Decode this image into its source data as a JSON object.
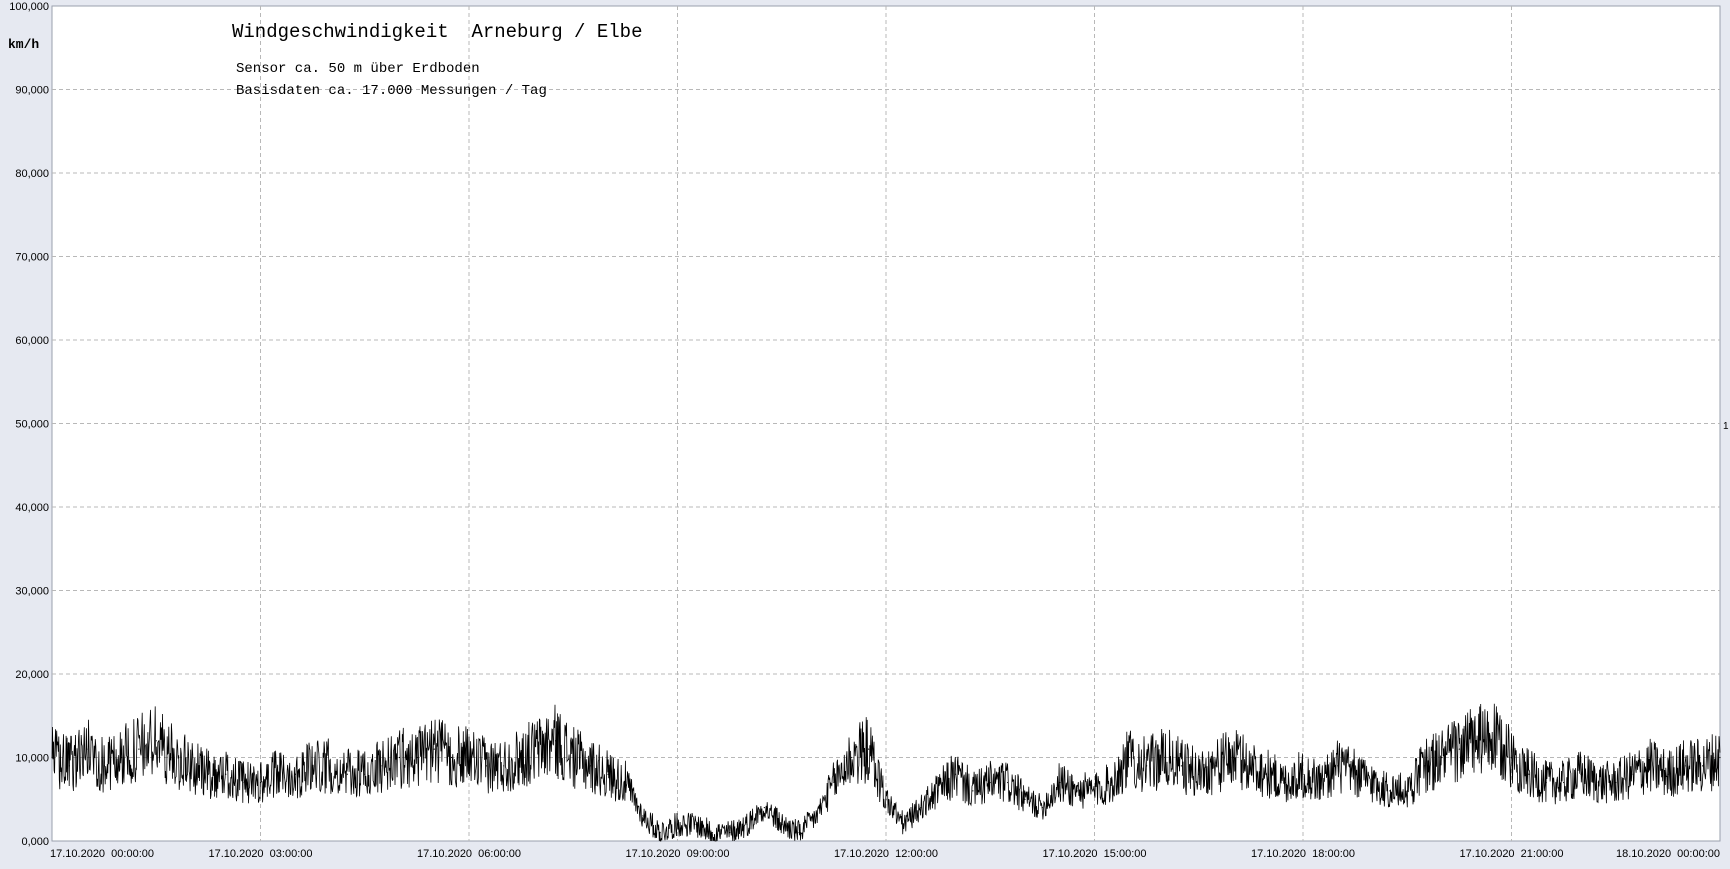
{
  "chart_data": {
    "type": "line",
    "title": "Windgeschwindigkeit  Arneburg / Elbe",
    "subtitle_lines": [
      "Sensor ca. 50 m über Erdboden",
      "Basisdaten ca. 17.000 Messungen / Tag"
    ],
    "ylabel": "km/h",
    "xlabel": "",
    "ylim": [
      0,
      100
    ],
    "yticks": [
      "0,000",
      "10,000",
      "20,000",
      "30,000",
      "40,000",
      "50,000",
      "60,000",
      "70,000",
      "80,000",
      "90,000",
      "100,000"
    ],
    "xlim_hours": [
      0,
      24
    ],
    "xticks": [
      "17.10.2020  00:00:00",
      "17.10.2020  03:00:00",
      "17.10.2020  06:00:00",
      "17.10.2020  09:00:00",
      "17.10.2020  12:00:00",
      "17.10.2020  15:00:00",
      "17.10.2020  18:00:00",
      "17.10.2020  21:00:00",
      "18.10.2020  00:00:00"
    ],
    "right_edge_label": "1",
    "grid": true,
    "legend": "none",
    "series": [
      {
        "color": "#000000",
        "x_hours": [
          0,
          0.25,
          0.5,
          0.75,
          1,
          1.25,
          1.5,
          1.75,
          2,
          2.25,
          2.5,
          2.75,
          3,
          3.25,
          3.5,
          3.75,
          4,
          4.25,
          4.5,
          4.75,
          5,
          5.25,
          5.5,
          5.75,
          6,
          6.25,
          6.5,
          6.75,
          7,
          7.25,
          7.5,
          7.75,
          8,
          8.25,
          8.5,
          8.75,
          9,
          9.25,
          9.5,
          9.75,
          10,
          10.25,
          10.5,
          10.75,
          11,
          11.25,
          11.5,
          11.75,
          12,
          12.25,
          12.5,
          12.75,
          13,
          13.25,
          13.5,
          13.75,
          14,
          14.25,
          14.5,
          14.75,
          15,
          15.25,
          15.5,
          15.75,
          16,
          16.25,
          16.5,
          16.75,
          17,
          17.25,
          17.5,
          17.75,
          18,
          18.25,
          18.5,
          18.75,
          19,
          19.25,
          19.5,
          19.75,
          20,
          20.25,
          20.5,
          20.75,
          21,
          21.25,
          21.5,
          21.75,
          22,
          22.25,
          22.5,
          22.75,
          23,
          23.25,
          23.5,
          23.75,
          24
        ],
        "values": [
          10,
          9,
          11,
          9,
          10,
          11,
          12,
          10,
          9,
          8,
          8,
          7,
          7,
          8,
          8,
          9,
          9,
          8,
          8,
          9,
          10,
          10,
          11,
          10,
          10,
          9,
          9,
          10,
          11,
          12,
          10,
          9,
          8,
          7,
          3,
          1,
          2,
          2,
          1,
          1,
          2,
          4,
          2,
          1,
          3,
          7,
          10,
          11,
          5,
          2,
          4,
          6,
          8,
          6,
          7,
          7,
          5,
          4,
          7,
          6,
          6,
          7,
          10,
          9,
          10,
          9,
          8,
          9,
          10,
          9,
          8,
          7,
          8,
          7,
          9,
          8,
          7,
          6,
          6,
          9,
          10,
          11,
          12,
          12,
          10,
          8,
          7,
          7,
          8,
          7,
          7,
          8,
          9,
          8,
          9,
          9,
          10,
          10,
          11
        ]
      }
    ]
  }
}
